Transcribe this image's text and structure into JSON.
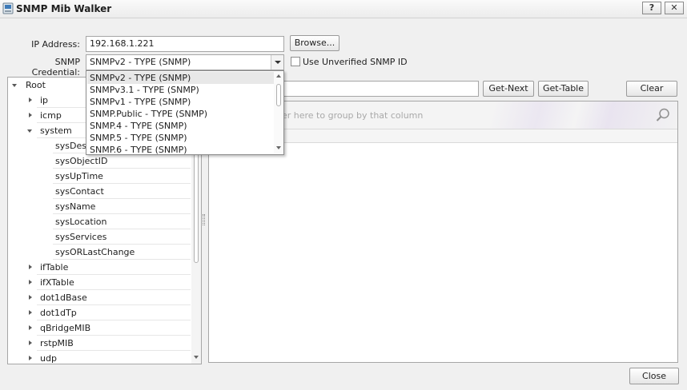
{
  "window": {
    "title": "SNMP Mib Walker",
    "help_label": "?",
    "close_glyph": "✕"
  },
  "form": {
    "ip_label": "IP Address:",
    "ip_value": "192.168.1.221",
    "browse_label": "Browse...",
    "credential_label": "SNMP Credential:",
    "credential_value": "SNMPv2 - TYPE (SNMP)",
    "unverified_label": "Use Unverified SNMP ID",
    "unverified_checked": false
  },
  "toolbar": {
    "get_next_label": "Get-Next",
    "get_table_label": "Get-Table",
    "clear_label": "Clear"
  },
  "credential_options": [
    "SNMPv2 - TYPE (SNMP)",
    "SNMPv3.1 - TYPE (SNMP)",
    "SNMPv1 - TYPE (SNMP)",
    "SNMP.Public - TYPE (SNMP)",
    "SNMP.4 - TYPE (SNMP)",
    "SNMP.5 - TYPE (SNMP)",
    "SNMP.6 - TYPE (SNMP)"
  ],
  "tree": {
    "root": "Root",
    "items": [
      {
        "label": "ip",
        "state": "collapsed",
        "level": 1
      },
      {
        "label": "icmp",
        "state": "collapsed",
        "level": 1
      },
      {
        "label": "system",
        "state": "expanded",
        "level": 1
      },
      {
        "label": "sysDescr",
        "state": "leaf",
        "level": 2
      },
      {
        "label": "sysObjectID",
        "state": "leaf",
        "level": 2
      },
      {
        "label": "sysUpTime",
        "state": "leaf",
        "level": 2
      },
      {
        "label": "sysContact",
        "state": "leaf",
        "level": 2
      },
      {
        "label": "sysName",
        "state": "leaf",
        "level": 2
      },
      {
        "label": "sysLocation",
        "state": "leaf",
        "level": 2
      },
      {
        "label": "sysServices",
        "state": "leaf",
        "level": 2
      },
      {
        "label": "sysORLastChange",
        "state": "leaf",
        "level": 2
      },
      {
        "label": "ifTable",
        "state": "collapsed",
        "level": 1
      },
      {
        "label": "ifXTable",
        "state": "collapsed",
        "level": 1
      },
      {
        "label": "dot1dBase",
        "state": "collapsed",
        "level": 1
      },
      {
        "label": "dot1dTp",
        "state": "collapsed",
        "level": 1
      },
      {
        "label": "qBridgeMIB",
        "state": "collapsed",
        "level": 1
      },
      {
        "label": "rstpMIB",
        "state": "collapsed",
        "level": 1
      },
      {
        "label": "udp",
        "state": "collapsed",
        "level": 1
      }
    ]
  },
  "grid": {
    "group_hint": "der here to group by that column"
  },
  "footer": {
    "close_label": "Close"
  },
  "colors": {
    "accent": "#7a5fb0",
    "border": "#a6a6a6"
  }
}
